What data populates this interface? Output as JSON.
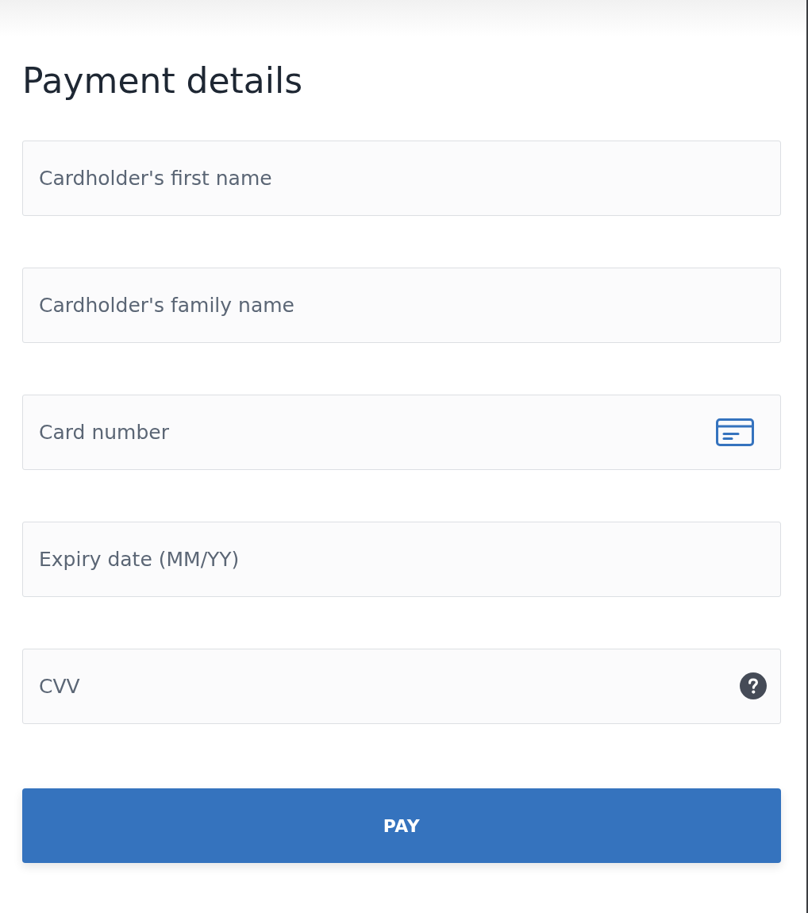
{
  "title": "Payment details",
  "fields": [
    {
      "placeholder": "Cardholder's first name",
      "kind": "plain"
    },
    {
      "placeholder": "Cardholder's family name",
      "kind": "plain"
    },
    {
      "placeholder": "Card number",
      "kind": "card"
    },
    {
      "placeholder": "Expiry date (MM/YY)",
      "kind": "plain"
    },
    {
      "placeholder": "CVV",
      "kind": "help"
    }
  ],
  "pay_button": {
    "label": "PAY"
  }
}
